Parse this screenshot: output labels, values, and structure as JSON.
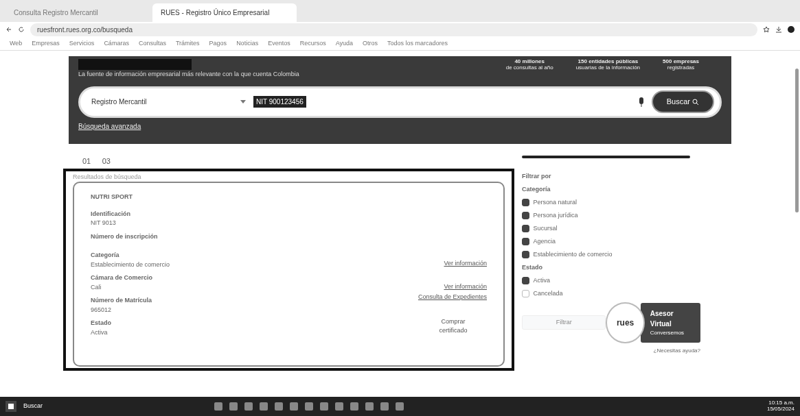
{
  "browser": {
    "tabs": [
      {
        "label": "Consulta Registro Mercantil",
        "selected": false
      },
      {
        "label": "RUES - Registro Único Empresarial",
        "selected": true
      }
    ],
    "address": "ruesfront.rues.org.co/busqueda",
    "bookmarks": [
      "Web",
      "Empresas",
      "Servicios",
      "Cámaras",
      "Consultas",
      "Trámites",
      "Pagos",
      "Noticias",
      "Eventos",
      "Recursos",
      "Ayuda",
      "Otros",
      "Todos los marcadores"
    ]
  },
  "hero": {
    "tagline": "La fuente de información empresarial más relevante con la que cuenta Colombia",
    "stats": [
      {
        "title": "40 millones",
        "sub": "de consultas al año"
      },
      {
        "title": "150 entidades públicas",
        "sub": "usuarias de la información"
      },
      {
        "title": "500 empresas",
        "sub": "registradas"
      }
    ]
  },
  "search": {
    "category": "Registro Mercantil",
    "query": "NIT 900123456",
    "button": "Buscar",
    "advanced": "Búsqueda avanzada"
  },
  "pager": [
    "01",
    "03"
  ],
  "result": {
    "heading": "Resultados de búsqueda",
    "name": "NUTRI SPORT",
    "fields": [
      {
        "label": "Identificación",
        "value": "NIT 9013"
      },
      {
        "label": "Número de inscripción"
      },
      {
        "label": "Categoría",
        "value": "Establecimiento de comercio"
      },
      {
        "label": "Cámara de Comercio",
        "value": "Cali"
      },
      {
        "label": "Número de Matrícula",
        "value": "965012"
      },
      {
        "label": "Estado",
        "value": "Activa"
      }
    ],
    "links": [
      "Ver información",
      "Ver información",
      "Consulta de Expedientes"
    ],
    "certificate": "Comprar certificado"
  },
  "filters": {
    "title": "Filtrar por",
    "groups": [
      {
        "title": "Categoría",
        "items": [
          {
            "label": "Persona natural",
            "checked": true
          },
          {
            "label": "Persona jurídica",
            "checked": true
          },
          {
            "label": "Sucursal",
            "checked": true
          },
          {
            "label": "Agencia",
            "checked": true
          },
          {
            "label": "Establecimiento de comercio",
            "checked": true
          }
        ]
      },
      {
        "title": "Estado",
        "items": [
          {
            "label": "Activa",
            "checked": true
          },
          {
            "label": "Cancelada",
            "checked": false
          }
        ]
      }
    ],
    "button": "Filtrar"
  },
  "assistant": {
    "logo": "rues",
    "title": "Asesor Virtual",
    "sub": "Conversemos",
    "hint": "¿Necesitas ayuda?"
  },
  "taskbar": {
    "search": "Buscar",
    "clock": "10:15 a.m.",
    "date": "15/05/2024"
  }
}
